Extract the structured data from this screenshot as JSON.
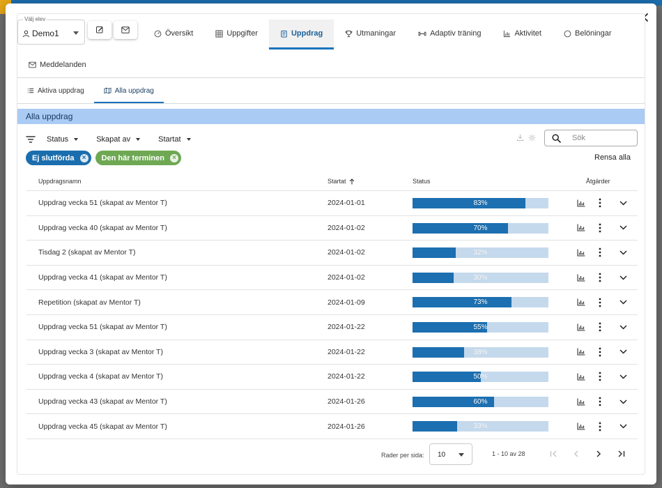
{
  "student": {
    "label": "Välj elev",
    "value": "Demo1"
  },
  "tabs": [
    {
      "label": "Översikt",
      "icon": "gauge-icon"
    },
    {
      "label": "Uppgifter",
      "icon": "grid-icon"
    },
    {
      "label": "Uppdrag",
      "icon": "clipboard-icon",
      "active": true
    },
    {
      "label": "Utmaningar",
      "icon": "trophy-icon"
    },
    {
      "label": "Adaptiv träning",
      "icon": "dumbbell-icon"
    },
    {
      "label": "Aktivitet",
      "icon": "bar-chart-icon"
    },
    {
      "label": "Belöningar",
      "icon": "circle-icon"
    }
  ],
  "tab_messages": {
    "label": "Meddelanden",
    "icon": "mail-icon"
  },
  "subtabs": [
    {
      "label": "Aktiva uppdrag",
      "icon": "list-icon"
    },
    {
      "label": "Alla uppdrag",
      "icon": "map-icon",
      "active": true
    }
  ],
  "section_title": "Alla uppdrag",
  "filters": {
    "status": "Status",
    "created_by": "Skapat av",
    "started": "Startat"
  },
  "search": {
    "placeholder": "Sök"
  },
  "chips": {
    "chip1": "Ej slutförda",
    "chip2": "Den här terminen"
  },
  "clear_all": "Rensa alla",
  "columns": {
    "name": "Uppdragsnamn",
    "started": "Startat",
    "status": "Status",
    "actions": "Åtgärder"
  },
  "rows": [
    {
      "name": "Uppdrag vecka 51 (skapat av Mentor T)",
      "date": "2024-01-01",
      "pct": 83,
      "pct_label": "83%"
    },
    {
      "name": "Uppdrag vecka 40 (skapat av Mentor T)",
      "date": "2024-01-02",
      "pct": 70,
      "pct_label": "70%"
    },
    {
      "name": "Tisdag 2 (skapat av Mentor T)",
      "date": "2024-01-02",
      "pct": 32,
      "pct_label": "32%"
    },
    {
      "name": "Uppdrag vecka 41 (skapat av Mentor T)",
      "date": "2024-01-02",
      "pct": 30,
      "pct_label": "30%"
    },
    {
      "name": "Repetition (skapat av Mentor T)",
      "date": "2024-01-09",
      "pct": 73,
      "pct_label": "73%"
    },
    {
      "name": "Uppdrag vecka 51 (skapat av Mentor T)",
      "date": "2024-01-22",
      "pct": 55,
      "pct_label": "55%"
    },
    {
      "name": "Uppdrag vecka 3 (skapat av Mentor T)",
      "date": "2024-01-22",
      "pct": 38,
      "pct_label": "38%"
    },
    {
      "name": "Uppdrag vecka 4 (skapat av Mentor T)",
      "date": "2024-01-22",
      "pct": 50,
      "pct_label": "50%"
    },
    {
      "name": "Uppdrag vecka 43 (skapat av Mentor T)",
      "date": "2024-01-26",
      "pct": 60,
      "pct_label": "60%"
    },
    {
      "name": "Uppdrag vecka 45 (skapat av Mentor T)",
      "date": "2024-01-26",
      "pct": 33,
      "pct_label": "33%"
    }
  ],
  "pagination": {
    "rows_label": "Rader per sida:",
    "rows_value": "10",
    "range": "1 - 10 av 28"
  },
  "colors": {
    "primary": "#1c6fb0",
    "bar_bg": "#c5d9ec",
    "section_bg": "#aacbf4",
    "chip_green": "#6ea853"
  }
}
